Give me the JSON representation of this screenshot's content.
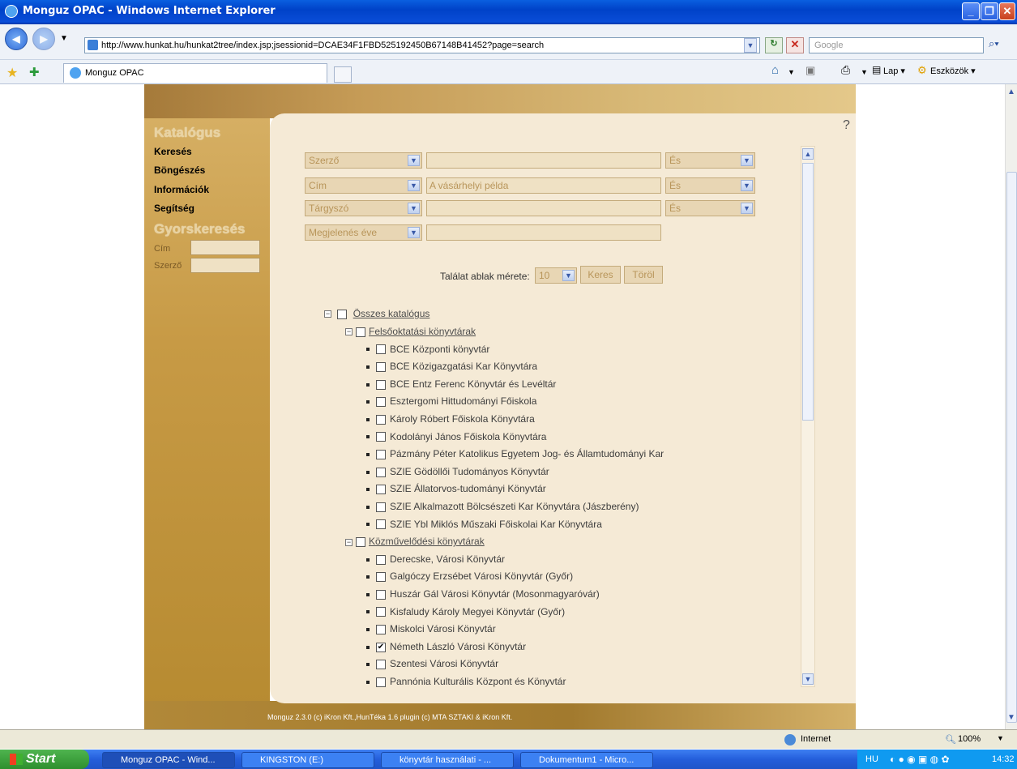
{
  "window": {
    "title": "Monguz OPAC - Windows Internet Explorer"
  },
  "browser": {
    "url": "http://www.hunkat.hu/hunkat2tree/index.jsp;jsessionid=DCAE34F1FBD525192450B67148B41452?page=search",
    "search_placeholder": "Google",
    "tab_title": "Monguz OPAC",
    "tools": {
      "page": "Lap",
      "tools": "Eszközök"
    }
  },
  "sidebar": {
    "catalog_heading": "Katalógus",
    "links": [
      "Keresés",
      "Böngészés",
      "Információk",
      "Segítség"
    ],
    "quick_heading": "Gyorskeresés",
    "quick_fields": [
      {
        "label": "Cím"
      },
      {
        "label": "Szerző"
      }
    ]
  },
  "help": "?",
  "search_rows": [
    {
      "field": "Szerző",
      "value": "",
      "op": "És"
    },
    {
      "field": "Cím",
      "value": "A vásárhelyi példa",
      "op": "És"
    },
    {
      "field": "Tárgyszó",
      "value": "",
      "op": "És"
    },
    {
      "field": "Megjelenés éve",
      "value": "",
      "op": ""
    }
  ],
  "result_size": {
    "label": "Találat ablak mérete:",
    "value": "10"
  },
  "buttons": {
    "search": "Keres",
    "clear": "Töröl"
  },
  "tree": {
    "root": "Összes katalógus",
    "groups": [
      {
        "name": "Felsőoktatási könyvtárak",
        "items": [
          {
            "name": "BCE Központi könyvtár",
            "checked": false
          },
          {
            "name": "BCE Közigazgatási Kar Könyvtára",
            "checked": false
          },
          {
            "name": "BCE Entz Ferenc Könyvtár és Levéltár",
            "checked": false
          },
          {
            "name": "Esztergomi Hittudományi Főiskola",
            "checked": false
          },
          {
            "name": "Károly Róbert Főiskola Könyvtára",
            "checked": false
          },
          {
            "name": "Kodolányi János Főiskola Könyvtára",
            "checked": false
          },
          {
            "name": "Pázmány Péter Katolikus Egyetem Jog- és Államtudományi Kar",
            "checked": false
          },
          {
            "name": "SZIE Gödöllői Tudományos Könyvtár",
            "checked": false
          },
          {
            "name": "SZIE Állatorvos-tudományi Könyvtár",
            "checked": false
          },
          {
            "name": "SZIE Alkalmazott Bölcsészeti Kar Könyvtára (Jászberény)",
            "checked": false
          },
          {
            "name": "SZIE Ybl Miklós Műszaki Főiskolai Kar Könyvtára",
            "checked": false
          }
        ]
      },
      {
        "name": "Közművelődési könyvtárak",
        "items": [
          {
            "name": "Derecske, Városi Könyvtár",
            "checked": false
          },
          {
            "name": "Galgóczy Erzsébet Városi Könyvtár (Győr)",
            "checked": false
          },
          {
            "name": "Huszár Gál Városi Könyvtár (Mosonmagyaróvár)",
            "checked": false
          },
          {
            "name": "Kisfaludy Károly Megyei Könyvtár (Győr)",
            "checked": false
          },
          {
            "name": "Miskolci Városi Könyvtár",
            "checked": false
          },
          {
            "name": "Németh László Városi Könyvtár",
            "checked": true
          },
          {
            "name": "Szentesi Városi Könyvtár",
            "checked": false
          },
          {
            "name": "Pannónia Kulturális Központ és Könyvtár",
            "checked": false
          }
        ]
      }
    ]
  },
  "footer": "Monguz 2.3.0 (c) iKron Kft.,HunTéka 1.6 plugin (c) MTA SZTAKI & iKron Kft.",
  "status": {
    "zone": "Internet",
    "zoom": "100%"
  },
  "taskbar": {
    "start": "Start",
    "tasks": [
      "Monguz OPAC - Wind...",
      "KINGSTON (E:)",
      "könyvtár használati - ...",
      "Dokumentum1 - Micro..."
    ],
    "lang": "HU",
    "clock": "14:32"
  }
}
